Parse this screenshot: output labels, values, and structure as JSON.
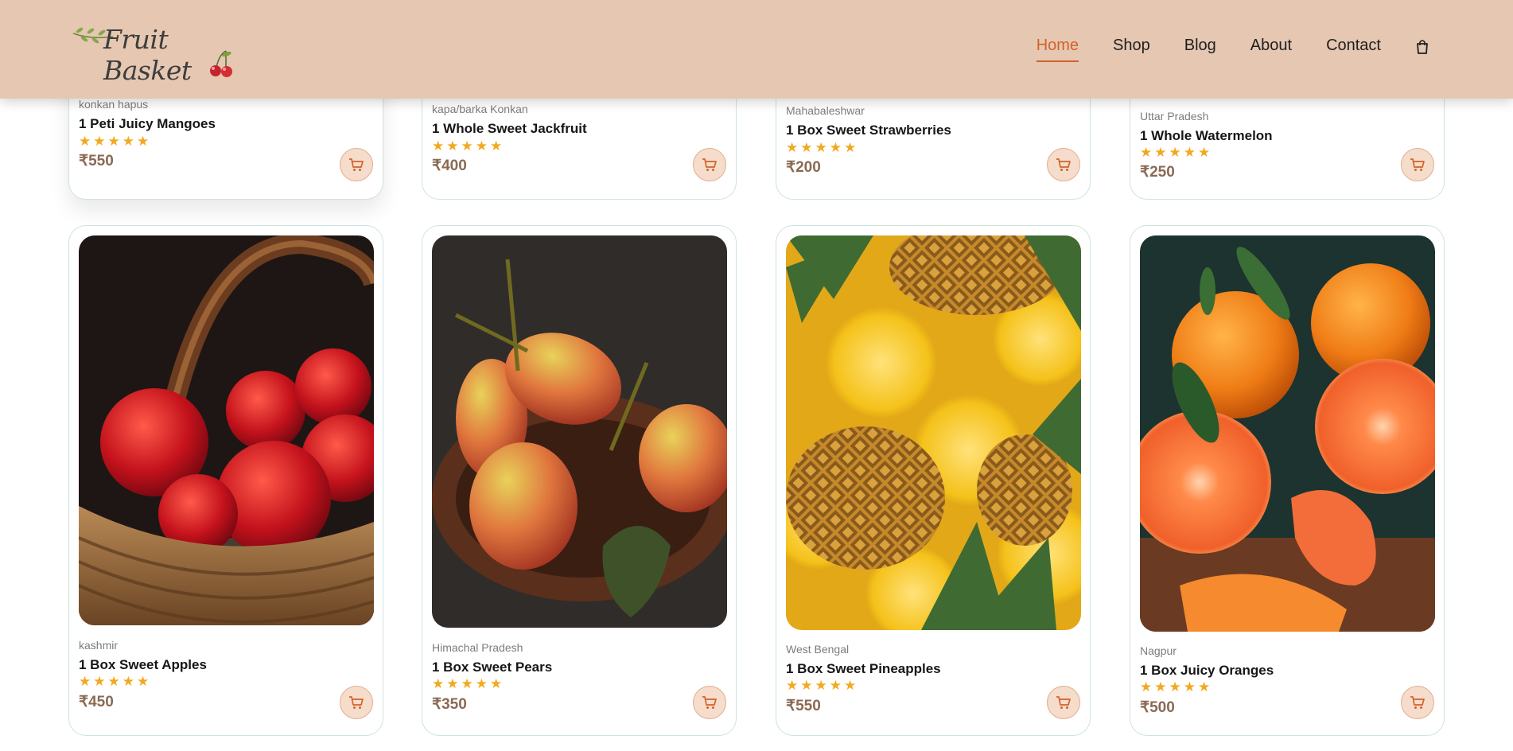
{
  "brand": {
    "logo_text": "Fruit Basket"
  },
  "nav": {
    "items": [
      "Home",
      "Shop",
      "Blog",
      "About",
      "Contact"
    ],
    "active": "Home",
    "accent": "#d1632b"
  },
  "colors": {
    "header_bg": "#e5c7b2",
    "star": "#f2a91f",
    "price": "#8a6a53",
    "cart_btn_bg": "#f6dccb"
  },
  "products_top": [
    {
      "origin": "konkan hapus",
      "title": "1 Peti Juicy Mangoes",
      "rating": 5,
      "price": "₹550"
    },
    {
      "origin": "kapa/barka Konkan",
      "title": "1 Whole Sweet Jackfruit",
      "rating": 5,
      "price": "₹400"
    },
    {
      "origin": "Mahabaleshwar",
      "title": "1 Box Sweet Strawberries",
      "rating": 5,
      "price": "₹200"
    },
    {
      "origin": "Uttar Pradesh",
      "title": "1 Whole Watermelon",
      "rating": 5,
      "price": "₹250"
    }
  ],
  "products_bottom": [
    {
      "origin": "kashmir",
      "title": "1 Box Sweet Apples",
      "rating": 5,
      "price": "₹450",
      "image": "apples-in-basket"
    },
    {
      "origin": "Himachal Pradesh",
      "title": "1 Box Sweet Pears",
      "rating": 5,
      "price": "₹350",
      "image": "pears-in-basket"
    },
    {
      "origin": "West Bengal",
      "title": "1 Box Sweet Pineapples",
      "rating": 5,
      "price": "₹550",
      "image": "pineapple-slices"
    },
    {
      "origin": "Nagpur",
      "title": "1 Box Juicy Oranges",
      "rating": 5,
      "price": "₹500",
      "image": "halved-oranges"
    }
  ],
  "stars_glyph": "★★★★★"
}
